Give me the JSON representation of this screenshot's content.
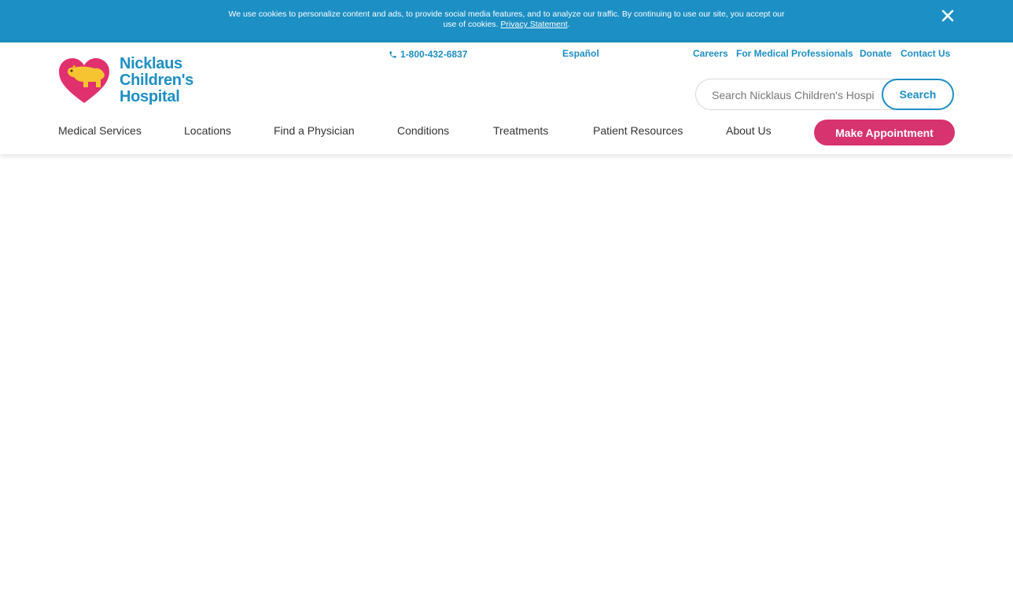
{
  "cookie_banner": {
    "text": "We use cookies to personalize content and ads, to provide social media features, and to analyze our traffic. By continuing to use our site, you accept our use of cookies.",
    "privacy_link": "Privacy Statement",
    "trailing": ".",
    "close_icon": "close-icon"
  },
  "logo": {
    "line1": "Nicklaus",
    "line2": "Children's",
    "line3": "Hospital",
    "icon": "heart-bear-icon",
    "heart_color": "#e0306d",
    "bear_color": "#f6c431"
  },
  "utility": {
    "phone": "1-800-432-6837",
    "phone_icon": "phone-icon",
    "espanol": "Español",
    "careers": "Careers",
    "professionals": "For Medical Professionals",
    "donate": "Donate",
    "contact": "Contact Us"
  },
  "search": {
    "placeholder": "Search Nicklaus Children's Hospital",
    "button": "Search"
  },
  "nav": {
    "items": [
      "Medical Services",
      "Locations",
      "Find a Physician",
      "Conditions",
      "Treatments",
      "Patient Resources",
      "About Us"
    ],
    "appointment": "Make Appointment"
  },
  "colors": {
    "brand_blue": "#1c8fc4",
    "brand_pink": "#d7336f"
  }
}
